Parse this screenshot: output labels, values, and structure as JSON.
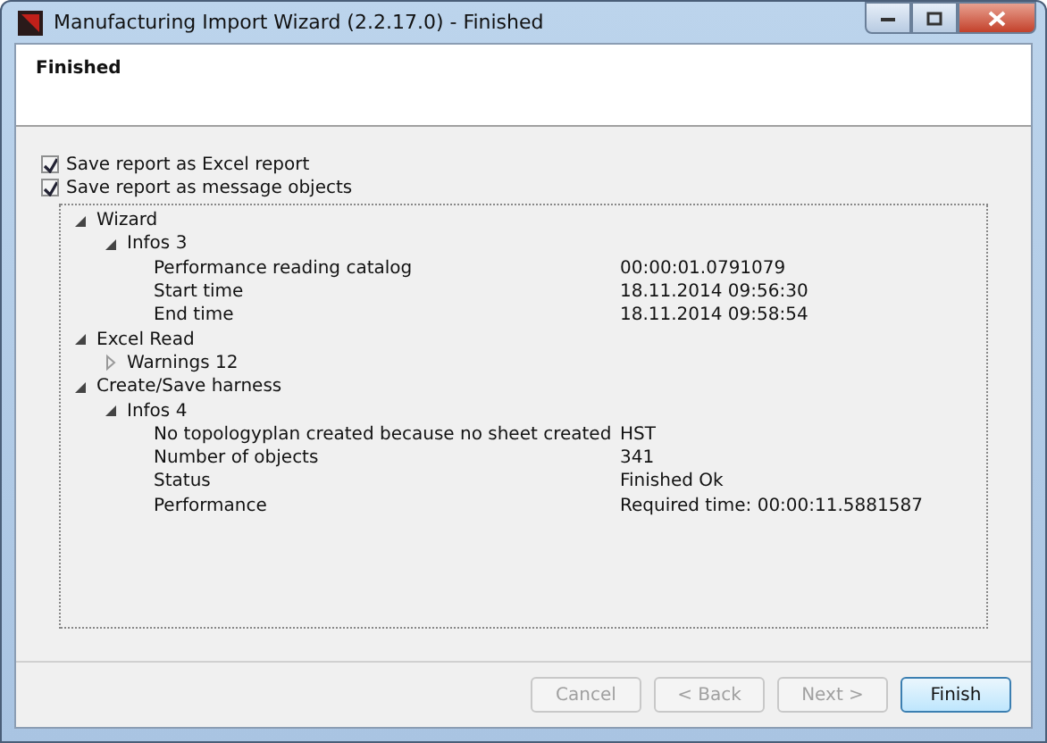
{
  "window": {
    "title": "Manufacturing Import Wizard (2.2.17.0) - Finished"
  },
  "header": {
    "title": "Finished"
  },
  "options": [
    {
      "label": "Save report as Excel report",
      "checked": true
    },
    {
      "label": "Save report as message objects",
      "checked": true
    }
  ],
  "tree": [
    {
      "label": "Wizard",
      "expanded": true,
      "children": [
        {
          "label": "Infos 3",
          "expanded": true,
          "children": [
            {
              "label": "Performance reading catalog",
              "value": "00:00:01.0791079"
            },
            {
              "label": "Start time",
              "value": "18.11.2014 09:56:30"
            },
            {
              "label": "End time",
              "value": "18.11.2014 09:58:54"
            }
          ]
        }
      ]
    },
    {
      "label": "Excel Read",
      "expanded": true,
      "children": [
        {
          "label": "Warnings 12",
          "expanded": false
        }
      ]
    },
    {
      "label": "Create/Save harness",
      "expanded": true,
      "children": [
        {
          "label": "Infos 4",
          "expanded": true,
          "children": [
            {
              "label": "No topologyplan created because no sheet created",
              "value": "HST"
            },
            {
              "label": "Number of objects",
              "value": "341"
            },
            {
              "label": "Status",
              "value": "Finished Ok"
            },
            {
              "label": "Performance",
              "value": "Required time:  00:00:11.5881587"
            }
          ]
        }
      ]
    }
  ],
  "buttons": [
    {
      "label": "Cancel",
      "disabled": true
    },
    {
      "label": "< Back",
      "disabled": true
    },
    {
      "label": "Next >",
      "disabled": true
    },
    {
      "label": "Finish",
      "disabled": false
    }
  ]
}
